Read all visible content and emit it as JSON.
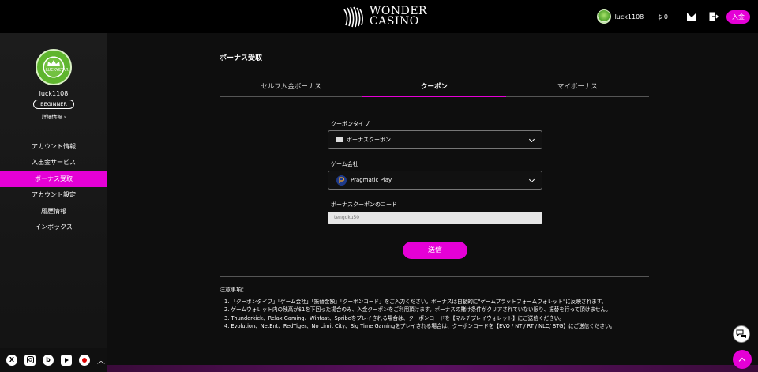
{
  "header": {
    "logo_line1": "WONDER",
    "logo_line2": "CASINO",
    "username": "luck1108",
    "balance": "$ 0",
    "deposit_label": "入金"
  },
  "sidebar": {
    "avatar_text": "LUCKYSTAR",
    "username": "luck1108",
    "rank": "BEGINNER",
    "detail": "詳細情報  ›",
    "items": [
      {
        "label": "アカウント情報"
      },
      {
        "label": "入出金サービス"
      },
      {
        "label": "ボーナス受取"
      },
      {
        "label": "アカウント設定"
      },
      {
        "label": "履歴情報"
      },
      {
        "label": "インボックス"
      }
    ],
    "active_index": 2,
    "social": [
      "X",
      "instagram-icon",
      "b",
      "youtube-icon"
    ]
  },
  "main": {
    "title": "ボーナス受取",
    "tabs": [
      {
        "label": "セルフ入金ボーナス"
      },
      {
        "label": "クーポン"
      },
      {
        "label": "マイボーナス"
      }
    ],
    "active_tab": 1,
    "coupon_type_label": "クーポンタイプ",
    "coupon_type_value": "ボーナスクーポン",
    "provider_label": "ゲーム会社",
    "provider_value": "Pragmatic Play",
    "code_label": "ボーナスクーポンのコード",
    "code_placeholder": "tengoku50",
    "submit_label": "送信",
    "notes_title": "注意事項：",
    "notes": [
      "1. 「クーポンタイプ」「ゲーム会社」「振替金額」「クーポンコード」をご入力ください。ボーナスは自動的に\"ゲームプラットフォームウォレット\"に反映されます。",
      "2. ゲームウォレット内の残高が$1を下回った場合のみ、入金クーポンをご利用頂けます。ボーナスの賭け条件がクリアされていない限り、振替を行って頂けません。",
      "3. Thunderkick、Relax Gaming、Winfast、Spribeをプレイされる場合は、クーポンコードを【マルチプレイウォレット】にご送信ください。",
      "4. Evolution、NetEnt、RedTiger、No Limit City、Big Time Gamingをプレイされる場合は、クーポンコードを【EVO / NT / RT / NLC/ BTG】にご送信ください。"
    ]
  },
  "colors": {
    "accent": "#e500d6",
    "background": "#0e0e0e",
    "sidebar": "#1c1c1c"
  }
}
